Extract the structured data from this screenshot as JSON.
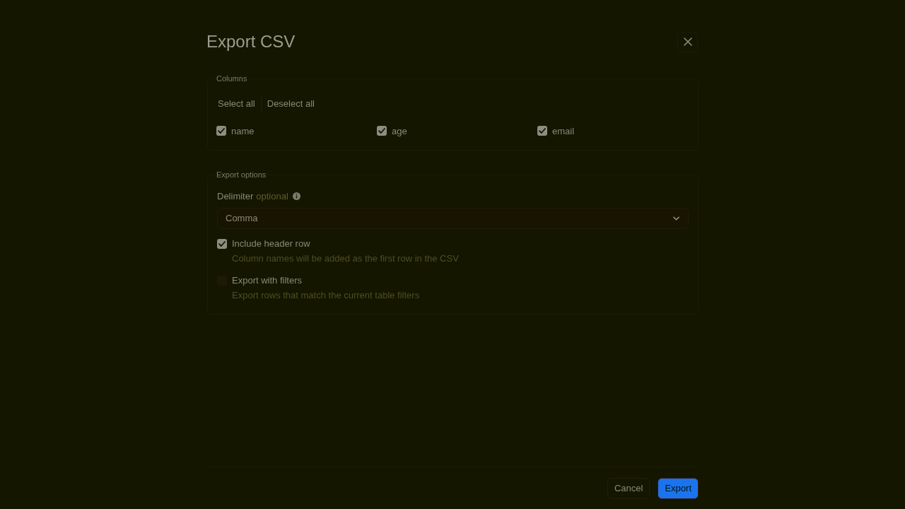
{
  "dialog": {
    "title": "Export CSV"
  },
  "columns_section": {
    "legend": "Columns",
    "actions": [
      "Select all",
      "Deselect all"
    ],
    "columns": [
      {
        "label": "name",
        "checked": true
      },
      {
        "label": "age",
        "checked": true
      },
      {
        "label": "email",
        "checked": true
      }
    ]
  },
  "options_section": {
    "legend": "Export options",
    "delimiter": {
      "label": "Delimiter",
      "optional_tag": "optional",
      "value": "Comma"
    },
    "options": [
      {
        "label": "Include header row",
        "description": "Column names will be added as the first row in the CSV",
        "checked": true
      },
      {
        "label": "Export with filters",
        "description": "Export rows that match the current table filters",
        "checked": false
      }
    ]
  },
  "footer": {
    "buttons": [
      {
        "label": "Cancel",
        "kind": "secondary"
      },
      {
        "label": "Export",
        "kind": "primary"
      }
    ]
  }
}
